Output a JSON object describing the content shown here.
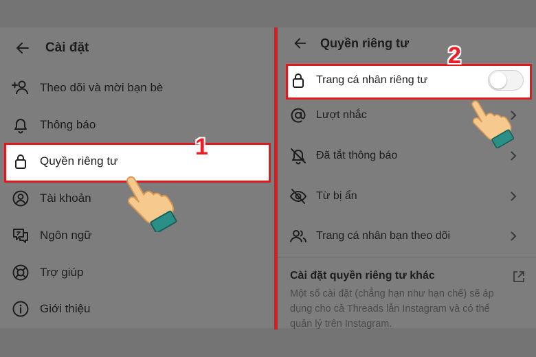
{
  "left_panel": {
    "title": "Cài đặt",
    "items": [
      {
        "label": "Theo dõi và mời bạn bè",
        "icon": "add-person-icon"
      },
      {
        "label": "Thông báo",
        "icon": "bell-icon"
      },
      {
        "label": "Quyền riêng tư",
        "icon": "lock-icon"
      },
      {
        "label": "Tài khoản",
        "icon": "account-circle-icon"
      },
      {
        "label": "Ngôn ngữ",
        "icon": "translate-icon"
      },
      {
        "label": "Trợ giúp",
        "icon": "lifebuoy-icon"
      },
      {
        "label": "Giới thiệu",
        "icon": "info-icon"
      }
    ]
  },
  "right_panel": {
    "title": "Quyền riêng tư",
    "private_profile": {
      "label": "Trang cá nhân riêng tư",
      "icon": "lock-icon",
      "enabled": false
    },
    "items": [
      {
        "label": "Lượt nhắc",
        "icon": "at-sign-icon"
      },
      {
        "label": "Đã tắt thông báo",
        "icon": "bell-off-icon"
      },
      {
        "label": "Từ bị ẩn",
        "icon": "eye-off-icon"
      },
      {
        "label": "Trang cá nhân bạn theo dõi",
        "icon": "people-icon"
      }
    ],
    "more": {
      "title": "Cài đặt quyền riêng tư khác",
      "description": "Một số cài đặt (chẳng hạn như hạn chế) sẽ áp dụng cho cả Threads lẫn Instagram và có thể quản lý trên Instagram."
    }
  },
  "annotations": {
    "step1": "1",
    "step2": "2"
  },
  "colors": {
    "highlight_border": "#e0191f",
    "background": "#7d7d7d",
    "text": "#1d1d1d"
  }
}
